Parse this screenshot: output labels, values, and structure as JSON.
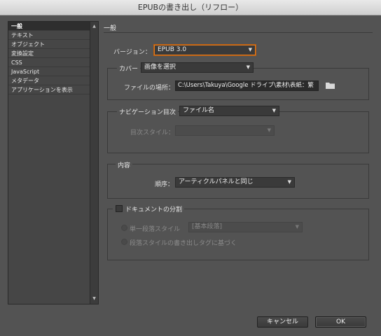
{
  "window": {
    "title": "EPUBの書き出し（リフロー）"
  },
  "sidebar": {
    "items": [
      {
        "label": "一般"
      },
      {
        "label": "テキスト"
      },
      {
        "label": "オブジェクト"
      },
      {
        "label": "変換設定"
      },
      {
        "label": "CSS"
      },
      {
        "label": "JavaScript"
      },
      {
        "label": "メタデータ"
      },
      {
        "label": "アプリケーションを表示"
      }
    ],
    "scroll_up_icon": "triangle-up",
    "scroll_down_icon": "triangle-down"
  },
  "main": {
    "header": "一般",
    "version": {
      "label": "バージョン：",
      "value": "EPUB 3.0"
    },
    "cover": {
      "label": "カバー",
      "value": "画像を選択",
      "file_label": "ファイルの場所：",
      "file_value": "C:\\Users\\Takuya\\Google ドライブ\\素材\\表紙：繁",
      "folder_icon": "folder-icon"
    },
    "nav": {
      "label": "ナビゲーション目次",
      "value": "ファイル名",
      "style_label": "目次スタイル：",
      "style_value": ""
    },
    "content": {
      "legend": "内容",
      "order_label": "順序：",
      "order_value": "アーティクルパネルと同じ"
    },
    "split": {
      "legend": "ドキュメントの分割",
      "checked": false,
      "single_label": "単一段落スタイル",
      "single_value": "[基本段落]",
      "tag_label": "段落スタイルの書き出しタグに基づく"
    }
  },
  "footer": {
    "cancel": "キャンセル",
    "ok": "OK"
  },
  "colors": {
    "background": "#535353",
    "focus_ring": "#e07a1f",
    "selected_item": "#2e2e2e"
  }
}
